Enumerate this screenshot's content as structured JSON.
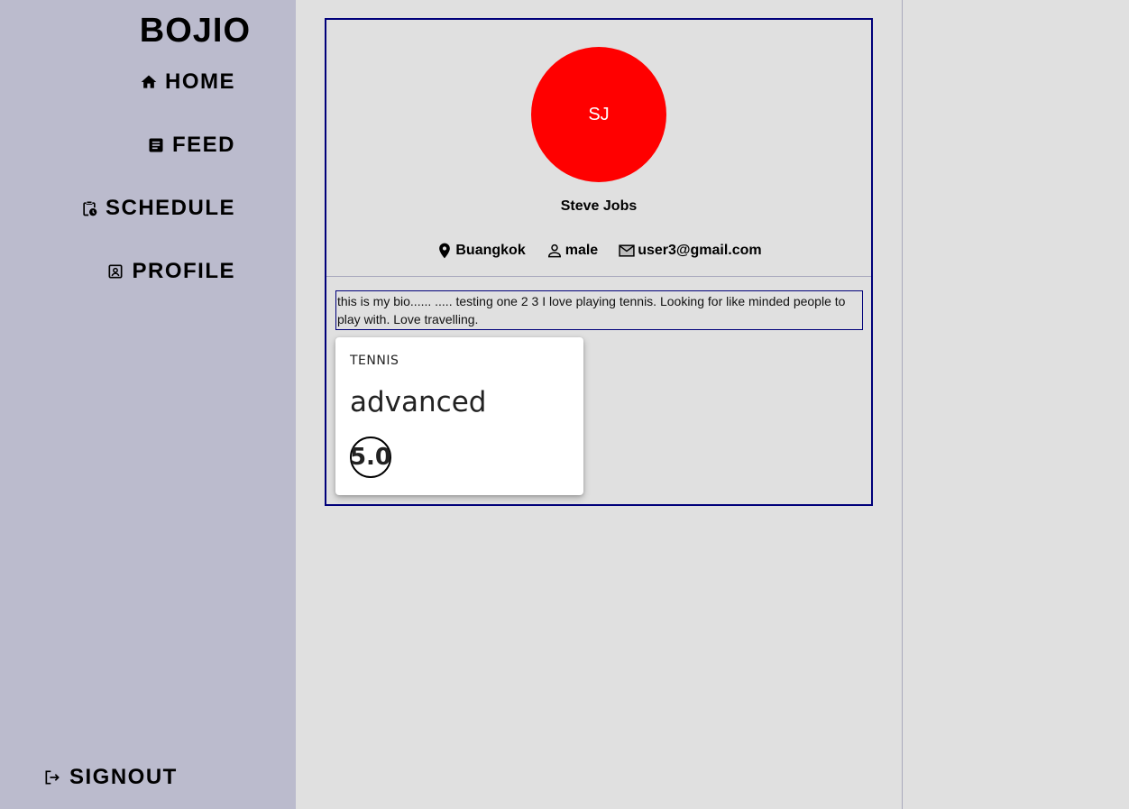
{
  "app": {
    "brand": "BOJIO"
  },
  "sidebar": {
    "items": [
      {
        "label": "HOME",
        "icon": "home-icon"
      },
      {
        "label": "FEED",
        "icon": "feed-icon"
      },
      {
        "label": "SCHEDULE",
        "icon": "schedule-icon"
      },
      {
        "label": "PROFILE",
        "icon": "profile-icon"
      }
    ],
    "signout": {
      "label": "SIGNOUT",
      "icon": "signout-icon"
    }
  },
  "profile": {
    "initials": "SJ",
    "name": "Steve Jobs",
    "location": "Buangkok",
    "gender": "male",
    "email": "user3@gmail.com",
    "bio": "this is my bio...... ..... testing one 2 3 I love playing tennis. Looking for like minded people to play with. Love travelling.",
    "avatar_color": "#ff0000"
  },
  "sports": [
    {
      "name": "TENNIS",
      "level": "advanced",
      "rating": "5.0"
    }
  ],
  "colors": {
    "sidebar_bg": "#bbbbcd",
    "page_bg": "#e0e0e0",
    "card_border": "#00007a"
  }
}
